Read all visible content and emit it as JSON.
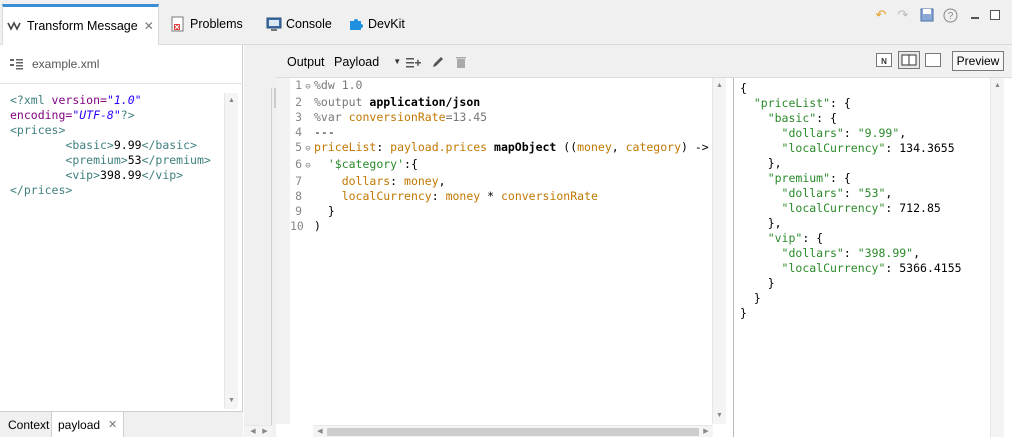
{
  "tabs": [
    {
      "label": "Transform Message",
      "active": true
    },
    {
      "label": "Problems"
    },
    {
      "label": "Console"
    },
    {
      "label": "DevKit"
    }
  ],
  "left": {
    "file": "example.xml",
    "xml": [
      {
        "parts": [
          [
            "t",
            "<?xml "
          ],
          [
            "a",
            "version="
          ],
          [
            "v",
            "\"1.0\""
          ]
        ]
      },
      {
        "parts": [
          [
            "a",
            "encoding="
          ],
          [
            "v",
            "\"UTF-8\""
          ],
          [
            "t",
            "?>"
          ]
        ]
      },
      {
        "parts": [
          [
            "t",
            "<prices>"
          ]
        ]
      },
      {
        "parts": [
          [
            "tx",
            "        "
          ],
          [
            "t",
            "<basic>"
          ],
          [
            "tx",
            "9.99"
          ],
          [
            "t",
            "</basic>"
          ]
        ]
      },
      {
        "parts": [
          [
            "tx",
            "        "
          ],
          [
            "t",
            "<premium>"
          ],
          [
            "tx",
            "53"
          ],
          [
            "t",
            "</premium>"
          ]
        ]
      },
      {
        "parts": [
          [
            "tx",
            "        "
          ],
          [
            "t",
            "<vip>"
          ],
          [
            "tx",
            "398.99"
          ],
          [
            "t",
            "</vip>"
          ]
        ]
      },
      {
        "parts": [
          [
            "t",
            "</prices>"
          ]
        ]
      }
    ],
    "bottom_tabs": {
      "context": "Context",
      "payload": "payload"
    }
  },
  "toolbar": {
    "output_label": "Output",
    "payload_value": "Payload",
    "preview_label": "Preview"
  },
  "script_lines": [
    {
      "n": "1",
      "fold": "⊖",
      "parts": [
        [
          "dir",
          "%dw 1.0"
        ]
      ]
    },
    {
      "n": "2",
      "fold": "",
      "parts": [
        [
          "dir",
          "%output "
        ],
        [
          "bold",
          "application/json"
        ]
      ]
    },
    {
      "n": "3",
      "fold": "",
      "parts": [
        [
          "dir",
          "%var "
        ],
        [
          "var",
          "conversionRate"
        ],
        [
          "dir",
          "=13.45"
        ]
      ]
    },
    {
      "n": "4",
      "fold": "",
      "parts": [
        [
          "plain",
          "---"
        ]
      ]
    },
    {
      "n": "5",
      "fold": "⊖",
      "parts": [
        [
          "var",
          "priceList"
        ],
        [
          "plain",
          ": "
        ],
        [
          "var",
          "payload.prices "
        ],
        [
          "bold",
          "mapObject"
        ],
        [
          "plain",
          " (("
        ],
        [
          "var",
          "money"
        ],
        [
          "plain",
          ", "
        ],
        [
          "var",
          "category"
        ],
        [
          "plain",
          ") ->"
        ]
      ]
    },
    {
      "n": "6",
      "fold": "⊖",
      "parts": [
        [
          "plain",
          "  "
        ],
        [
          "str",
          "'$category'"
        ],
        [
          "plain",
          ":{"
        ]
      ]
    },
    {
      "n": "7",
      "fold": "",
      "parts": [
        [
          "plain",
          "    "
        ],
        [
          "var",
          "dollars"
        ],
        [
          "plain",
          ": "
        ],
        [
          "var",
          "money"
        ],
        [
          "plain",
          ","
        ]
      ]
    },
    {
      "n": "8",
      "fold": "",
      "parts": [
        [
          "plain",
          "    "
        ],
        [
          "var",
          "localCurrency"
        ],
        [
          "plain",
          ": "
        ],
        [
          "var",
          "money"
        ],
        [
          "plain",
          " * "
        ],
        [
          "var",
          "conversionRate"
        ]
      ]
    },
    {
      "n": "9",
      "fold": "",
      "parts": [
        [
          "plain",
          "  }"
        ]
      ]
    },
    {
      "n": "10",
      "fold": "",
      "parts": [
        [
          "plain",
          ")"
        ]
      ]
    }
  ],
  "json_lines": [
    [
      [
        "p",
        "{"
      ]
    ],
    [
      [
        "p",
        "  "
      ],
      [
        "s",
        "\"priceList\""
      ],
      [
        "p",
        ": {"
      ]
    ],
    [
      [
        "p",
        "    "
      ],
      [
        "s",
        "\"basic\""
      ],
      [
        "p",
        ": {"
      ]
    ],
    [
      [
        "p",
        "      "
      ],
      [
        "s",
        "\"dollars\""
      ],
      [
        "p",
        ": "
      ],
      [
        "s",
        "\"9.99\""
      ],
      [
        "p",
        ","
      ]
    ],
    [
      [
        "p",
        "      "
      ],
      [
        "s",
        "\"localCurrency\""
      ],
      [
        "p",
        ": 134.3655"
      ]
    ],
    [
      [
        "p",
        "    },"
      ]
    ],
    [
      [
        "p",
        "    "
      ],
      [
        "s",
        "\"premium\""
      ],
      [
        "p",
        ": {"
      ]
    ],
    [
      [
        "p",
        "      "
      ],
      [
        "s",
        "\"dollars\""
      ],
      [
        "p",
        ": "
      ],
      [
        "s",
        "\"53\""
      ],
      [
        "p",
        ","
      ]
    ],
    [
      [
        "p",
        "      "
      ],
      [
        "s",
        "\"localCurrency\""
      ],
      [
        "p",
        ": 712.85"
      ]
    ],
    [
      [
        "p",
        "    },"
      ]
    ],
    [
      [
        "p",
        "    "
      ],
      [
        "s",
        "\"vip\""
      ],
      [
        "p",
        ": {"
      ]
    ],
    [
      [
        "p",
        "      "
      ],
      [
        "s",
        "\"dollars\""
      ],
      [
        "p",
        ": "
      ],
      [
        "s",
        "\"398.99\""
      ],
      [
        "p",
        ","
      ]
    ],
    [
      [
        "p",
        "      "
      ],
      [
        "s",
        "\"localCurrency\""
      ],
      [
        "p",
        ": 5366.4155"
      ]
    ],
    [
      [
        "p",
        "    }"
      ]
    ],
    [
      [
        "p",
        "  }"
      ]
    ],
    [
      [
        "p",
        "}"
      ]
    ]
  ],
  "colors": {
    "accent": "#3c8cd6",
    "tag": "#3f7f7f",
    "attr": "#7f007f",
    "string": "#2a00ff",
    "json_string": "#2a8a2a",
    "var": "#c07700"
  }
}
